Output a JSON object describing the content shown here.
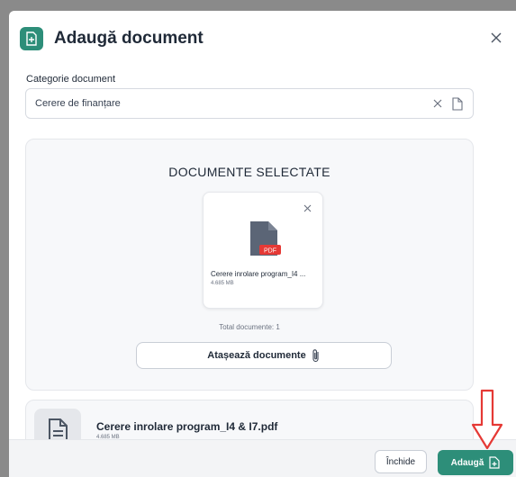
{
  "dialog": {
    "title": "Adaugă document"
  },
  "category": {
    "label": "Categorie document",
    "value": "Cerere de finanțare"
  },
  "selected": {
    "heading": "DOCUMENTE SELECTATE",
    "file": {
      "name": "Cerere inrolare program_I4 ...",
      "size": "4.685 MB",
      "badge": "PDF"
    },
    "total": "Total documente: 1",
    "attach_label": "Atașează documente"
  },
  "list": [
    {
      "name": "Cerere inrolare program_I4 & I7.pdf",
      "size": "4.685 MB"
    }
  ],
  "footer": {
    "close_label": "Închide",
    "add_label": "Adaugă"
  },
  "colors": {
    "accent": "#2d8e79",
    "pdf_badge": "#e53935",
    "arrow": "#e53935"
  }
}
